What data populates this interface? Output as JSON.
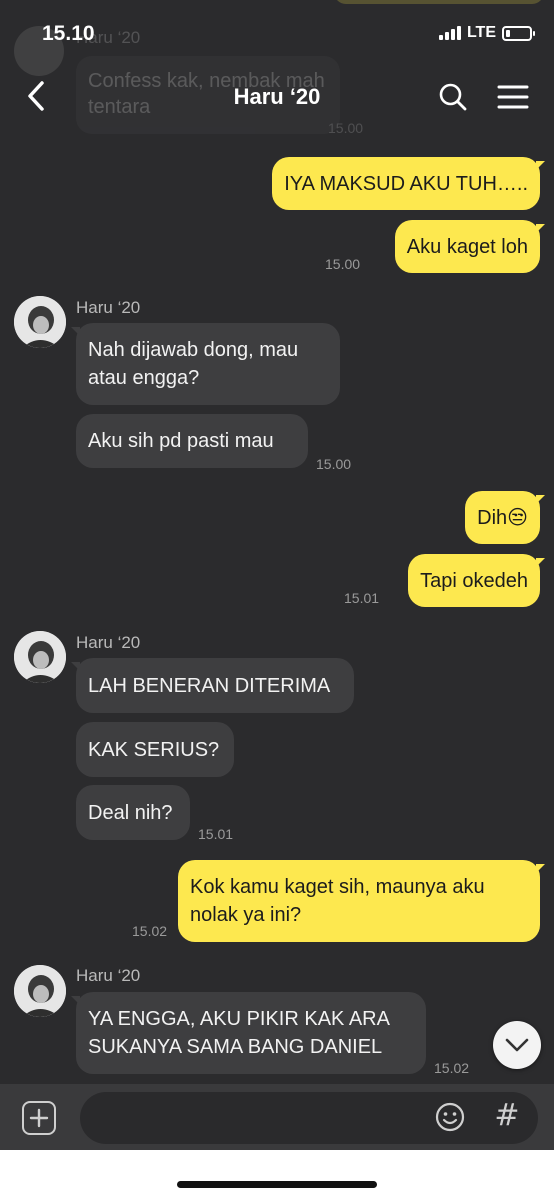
{
  "status_bar": {
    "time": "15.10",
    "network": "LTE",
    "battery_level": 0.18
  },
  "header": {
    "title": "Haru ‘20",
    "back_icon": "back-chevron-icon",
    "search_icon": "search-icon",
    "menu_icon": "hamburger-menu-icon"
  },
  "faded_message": {
    "sender": "Haru ‘20",
    "text": "Confess kak, nembak mah tentara",
    "time": "15.00"
  },
  "messages": {
    "out1": {
      "text": "IYA MAKSUD AKU TUH….."
    },
    "out2": {
      "text": "Aku kaget loh",
      "time": "15.00"
    },
    "group1": {
      "sender": "Haru ‘20",
      "m1": "Nah dijawab dong, mau atau engga?",
      "m2": "Aku sih pd pasti mau",
      "time": "15.00"
    },
    "out3": {
      "text": "Dih😒"
    },
    "out4": {
      "text": "Tapi okedeh",
      "time": "15.01"
    },
    "group2": {
      "sender": "Haru ‘20",
      "m1": "LAH BENERAN DITERIMA",
      "m2": "KAK SERIUS?",
      "m3": "Deal nih?",
      "time": "15.01"
    },
    "out5": {
      "text": "Kok kamu kaget sih, maunya aku nolak ya ini?",
      "time": "15.02"
    },
    "group3": {
      "sender": "Haru ‘20",
      "m1": "YA ENGGA, AKU PIKIR KAK ARA SUKANYA SAMA BANG DANIEL",
      "time": "15.02"
    }
  },
  "composer": {
    "placeholder": "",
    "plus_icon": "plus-icon",
    "emoji_icon": "emoji-icon",
    "hash_label": "#"
  },
  "colors": {
    "background": "#2b2b2d",
    "incoming_bubble": "#3e3e40",
    "outgoing_bubble": "#fde84f",
    "timestamp": "#9a9a9a"
  }
}
